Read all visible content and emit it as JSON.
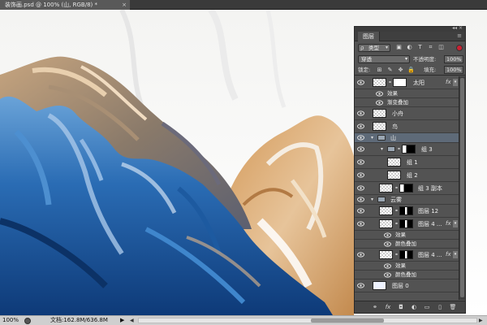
{
  "document": {
    "tab_title": "装饰画.psd @ 100% (山, RGB/8) *",
    "close_glyph": "×"
  },
  "statusbar": {
    "zoom": "100%",
    "doc_info": "文档:162.8M/636.8M",
    "play_glyph": "▶",
    "left_glyph": "◀",
    "right_glyph": "▶"
  },
  "layers_panel": {
    "title": "图层",
    "collapse_glyph": "◂◂ ×",
    "menu_glyph": "≡",
    "filter": {
      "kind_icon": "ρ",
      "kind_label": "类型",
      "arrow": "▾"
    },
    "filter_icons": [
      "▣",
      "◐",
      "T",
      "⌗",
      "◫"
    ],
    "blend_mode": "穿透",
    "opacity_label": "不透明度:",
    "opacity_value": "100%",
    "lock_label": "锁定:",
    "lock_icons": [
      "⊞",
      "✎",
      "✥",
      "🔒"
    ],
    "fill_label": "填充:",
    "fill_value": "100%",
    "fx_label": "fx",
    "layers": [
      {
        "name": "太阳",
        "type": "layer",
        "thumb": "checker",
        "mask": "white",
        "fx": true
      },
      {
        "name": "效果",
        "type": "effects"
      },
      {
        "name": "渐变叠加",
        "type": "effect"
      },
      {
        "name": "小舟",
        "type": "layer",
        "thumb": "checker"
      },
      {
        "name": "鸟",
        "type": "layer",
        "thumb": "checker"
      },
      {
        "name": "山",
        "type": "group",
        "open": true,
        "selected": true
      },
      {
        "name": "组 3",
        "type": "group",
        "open": true,
        "mask": "dark",
        "indent": 1
      },
      {
        "name": "组 1",
        "type": "layer",
        "thumb": "checker",
        "indent": 2
      },
      {
        "name": "组 2",
        "type": "layer",
        "thumb": "checker",
        "indent": 2
      },
      {
        "name": "组 3 副本",
        "type": "layer",
        "thumb": "checker",
        "mask": "dark",
        "indent": 1
      },
      {
        "name": "云雾",
        "type": "group",
        "open": true
      },
      {
        "name": "图层 12",
        "type": "layer",
        "thumb": "checker",
        "mask": "mix",
        "indent": 1
      },
      {
        "name": "图层 4 ...",
        "type": "layer",
        "thumb": "checker",
        "mask": "mix",
        "indent": 1,
        "fx": true
      },
      {
        "name": "效果",
        "type": "effects",
        "indent": 1
      },
      {
        "name": "颜色叠加",
        "type": "effect",
        "indent": 1
      },
      {
        "name": "图层 4 ...",
        "type": "layer",
        "thumb": "checker",
        "mask": "mix",
        "indent": 1,
        "fx": true
      },
      {
        "name": "效果",
        "type": "effects",
        "indent": 1
      },
      {
        "name": "颜色叠加",
        "type": "effect",
        "indent": 1
      },
      {
        "name": "图层 0",
        "type": "layer",
        "thumb": "blue"
      }
    ],
    "bottom_icons": [
      "⚭",
      "fx",
      "◘",
      "◐",
      "▭",
      "▯",
      "🗑"
    ]
  }
}
